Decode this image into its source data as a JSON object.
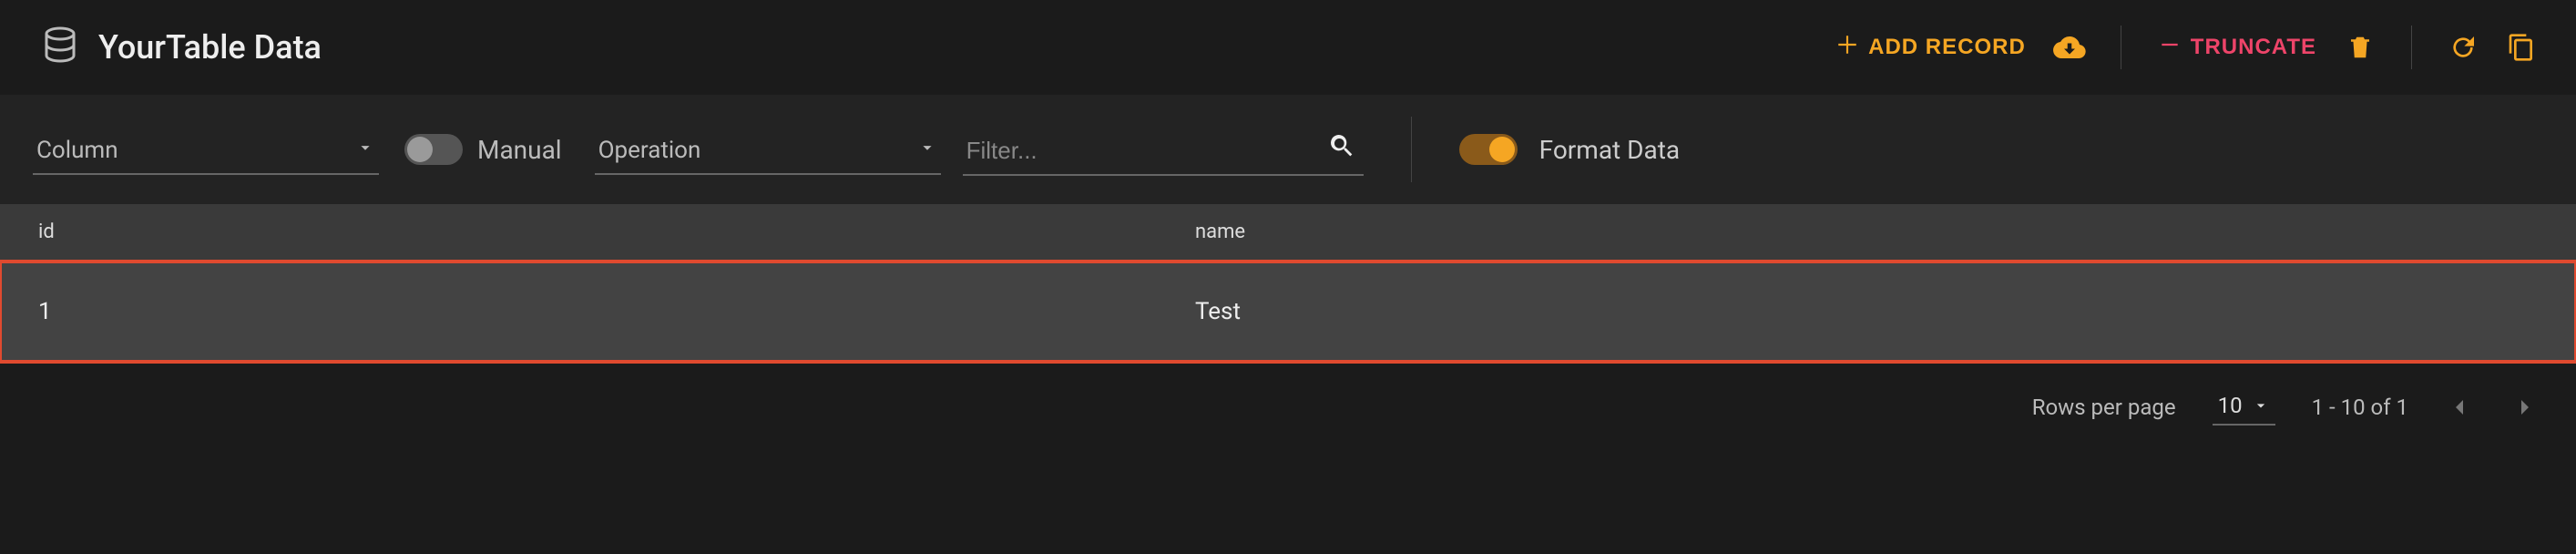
{
  "header": {
    "title": "YourTable Data",
    "add_record_label": "ADD RECORD",
    "truncate_label": "TRUNCATE"
  },
  "filters": {
    "column_dropdown_label": "Column",
    "manual_label": "Manual",
    "manual_on": false,
    "operation_dropdown_label": "Operation",
    "filter_placeholder": "Filter...",
    "format_data_label": "Format Data",
    "format_data_on": true
  },
  "table": {
    "columns": [
      "id",
      "name"
    ],
    "rows": [
      {
        "id": "1",
        "name": "Test",
        "highlight": true
      }
    ]
  },
  "pagination": {
    "rows_per_page_label": "Rows per page",
    "rows_per_page_value": "10",
    "range_text": "1 - 10 of 1"
  },
  "colors": {
    "accent": "#f5a623",
    "danger": "#ee4469",
    "highlight_border": "#e04a2f"
  }
}
